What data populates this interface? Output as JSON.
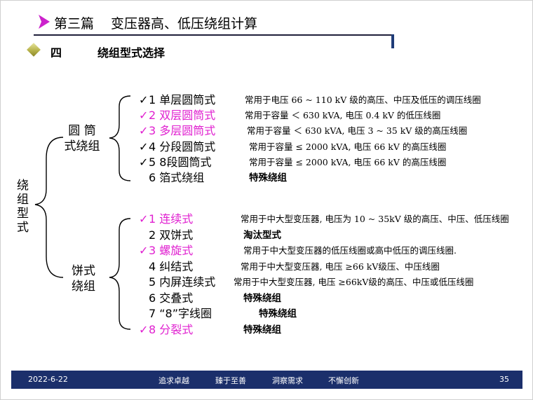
{
  "header": {
    "part": "第三篇",
    "title": "变压器高、低压绕组计算"
  },
  "section": {
    "number": "四",
    "title": "绕组型式选择"
  },
  "root_label": "绕组型式",
  "groups": [
    {
      "label_line1": "圆  筒",
      "label_line2": "式绕组",
      "items": [
        {
          "text": "1  单层圆筒式",
          "desc": "常用于电压  66 ~ 110 kV  级的高压、中压及低压的调压线圈",
          "highlight": false,
          "check": true
        },
        {
          "text": "2  双层圆筒式",
          "desc": "常用于容量  ＜ 630 kVA,   电压  0.4 kV  的低压线圈",
          "highlight": true,
          "check": true
        },
        {
          "text": "3  多层圆筒式",
          "desc": "常用于容量  ＜ 630 kVA,   电压  3 ~ 35 kV  级的高压线圈",
          "highlight": true,
          "check": true
        },
        {
          "text": "4  分段圆筒式",
          "desc": "常用于容量  ≤  2000 kVA, 电压  66 kV  的高压线圈",
          "highlight": false,
          "check": true
        },
        {
          "text": "5  8段圆筒式",
          "desc": "常用于容量  ≤  2000 kVA, 电压  66 kV  的高压线圈",
          "highlight": false,
          "check": true
        },
        {
          "text": "6  箔式绕组",
          "desc": "特殊绕组",
          "highlight": false,
          "check": false
        }
      ]
    },
    {
      "label_line1": "饼式",
      "label_line2": "绕组",
      "items": [
        {
          "text": "1   连续式",
          "desc": "常用于中大型变压器, 电压为  10 ~ 35kV  级的高压、中压、低压线圈",
          "highlight": true,
          "check": true
        },
        {
          "text": "2   双饼式",
          "desc": "淘汰型式",
          "highlight": false,
          "check": false
        },
        {
          "text": "3   螺旋式",
          "desc": "常用于中大型变压器的低压线圈或高中低压的调压线圈.",
          "highlight": true,
          "check": true
        },
        {
          "text": "4   纠结式",
          "desc": "常用于中大型变压器, 电压 ≥66  kV级压、中压线圈",
          "highlight": false,
          "check": false
        },
        {
          "text": "5   内屏连续式",
          "desc": "常用于中大型变压器, 电压 ≥66kV级的高压、中压或低压线圈",
          "highlight": false,
          "check": false
        },
        {
          "text": "6   交叠式",
          "desc": "特殊绕组",
          "highlight": false,
          "check": false
        },
        {
          "text": "7  “8”字线圈",
          "desc": "特殊绕组",
          "highlight": false,
          "check": false
        },
        {
          "text": "8  分裂式",
          "desc": "特殊绕组",
          "highlight": true,
          "check": true
        }
      ]
    }
  ],
  "footer": {
    "date": "2022-6-22",
    "slogan1": "追求卓越",
    "slogan2": "臻于至善",
    "slogan3": "洞察需求",
    "slogan4": "不懈创新",
    "page": "35"
  },
  "colors": {
    "highlight": "#e020d0",
    "footer_bg": "#1b2f6b",
    "arrow": "#cc22cc"
  }
}
